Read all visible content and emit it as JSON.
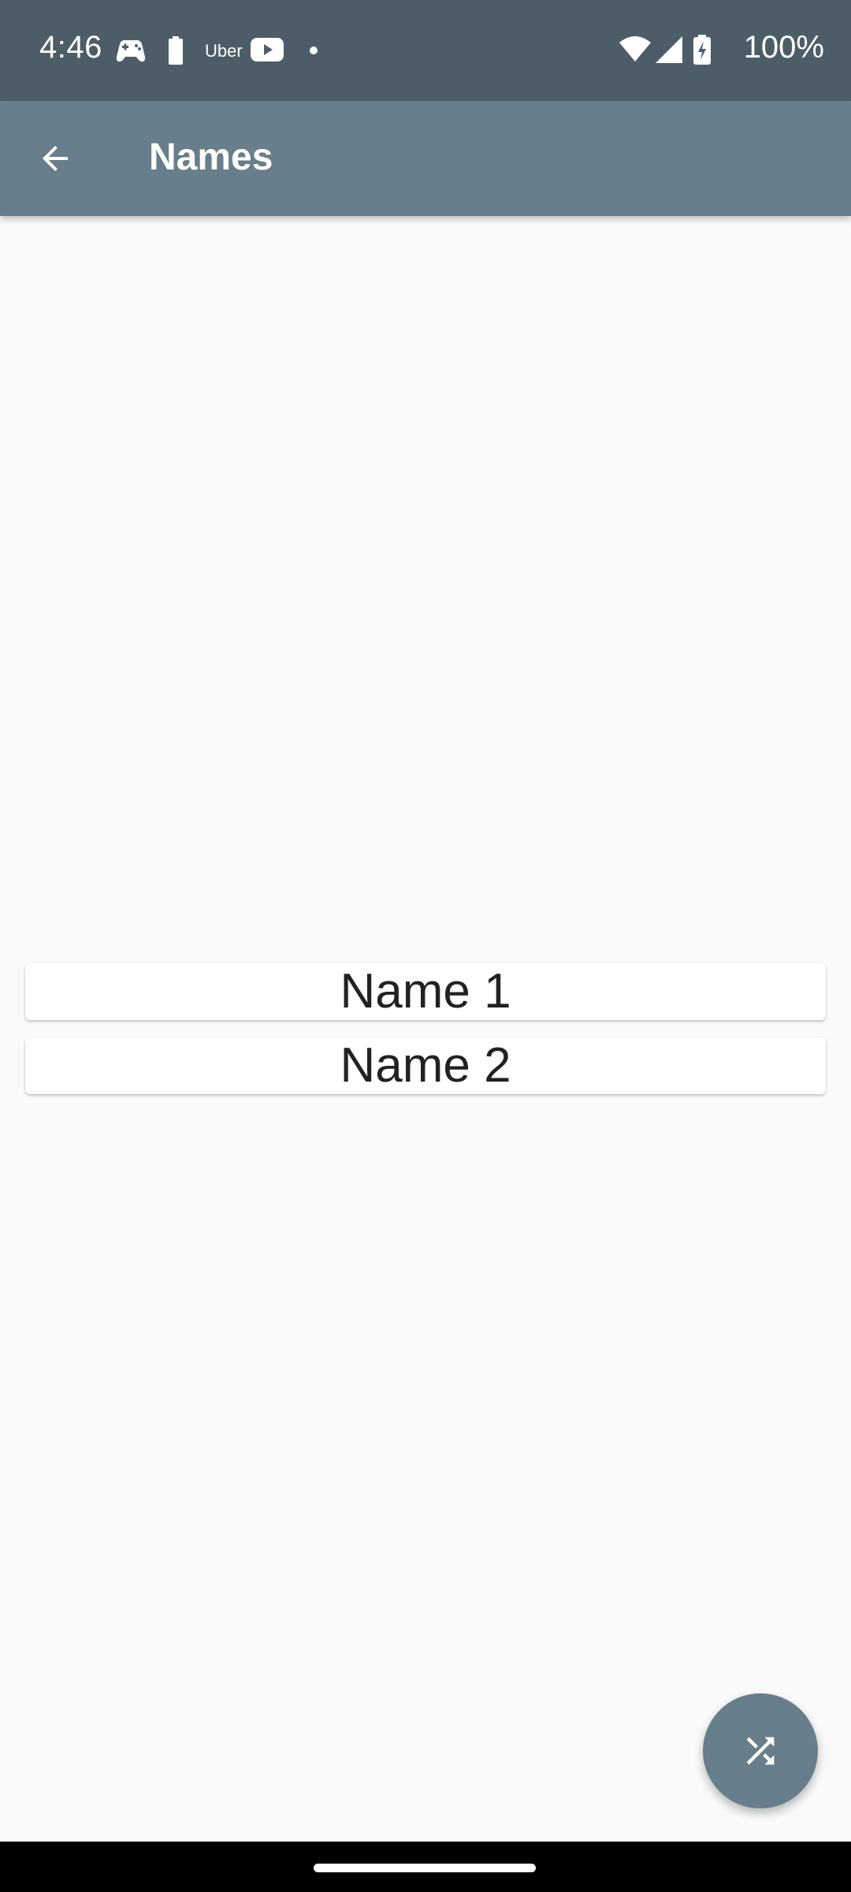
{
  "status_bar": {
    "time": "4:46",
    "battery_percent": "100%",
    "uber_label": "Uber",
    "icons": [
      "game-controller-icon",
      "battery-icon",
      "uber-icon",
      "youtube-icon",
      "dot-icon",
      "wifi-icon",
      "signal-icon",
      "battery-charging-icon"
    ]
  },
  "app_bar": {
    "title": "Names",
    "back_icon": "arrow-back-icon",
    "color": "#687e8a"
  },
  "names": [
    {
      "label": "Name 1"
    },
    {
      "label": "Name 2"
    }
  ],
  "fab": {
    "icon": "shuffle-icon",
    "color": "#687e8a"
  },
  "colors": {
    "status_bar": "#4c5d68",
    "background": "#fafafa",
    "card": "#ffffff"
  }
}
